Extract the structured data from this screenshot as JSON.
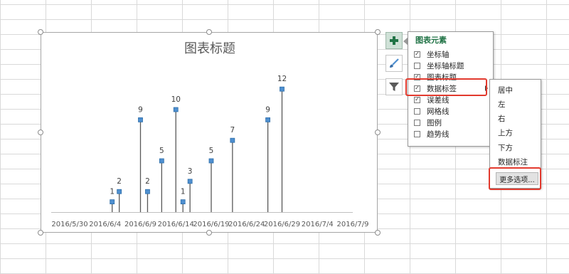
{
  "spreadsheet": {
    "gridline_color": "#d9d9d9"
  },
  "chart": {
    "title": "图表标题"
  },
  "chart_data": {
    "type": "scatter",
    "style": "drop-lines",
    "title": "图表标题",
    "x_tick_labels": [
      "2016/5/30",
      "2016/6/4",
      "2016/6/9",
      "2016/6/14",
      "2016/6/19",
      "2016/6/24",
      "2016/6/29",
      "2016/7/4",
      "2016/7/9"
    ],
    "xlim": [
      "2016/5/30",
      "2016/7/9"
    ],
    "ylim": [
      0,
      13
    ],
    "points": [
      {
        "x": "2016/6/5",
        "y": 1
      },
      {
        "x": "2016/6/6",
        "y": 2
      },
      {
        "x": "2016/6/9",
        "y": 9
      },
      {
        "x": "2016/6/10",
        "y": 2
      },
      {
        "x": "2016/6/12",
        "y": 5
      },
      {
        "x": "2016/6/14",
        "y": 10
      },
      {
        "x": "2016/6/15",
        "y": 1
      },
      {
        "x": "2016/6/16",
        "y": 3
      },
      {
        "x": "2016/6/19",
        "y": 5
      },
      {
        "x": "2016/6/22",
        "y": 7
      },
      {
        "x": "2016/6/27",
        "y": 9
      },
      {
        "x": "2016/6/29",
        "y": 12
      }
    ],
    "marker_color": "#4e8fd0",
    "line_color": "#595959",
    "data_labels": true,
    "legend": "none"
  },
  "chart_buttons": {
    "elements_icon": "plus-icon",
    "styles_icon": "brush-icon",
    "filter_icon": "funnel-icon"
  },
  "elements_panel": {
    "title": "图表元素",
    "items": [
      {
        "label": "坐标轴",
        "checked": true
      },
      {
        "label": "坐标轴标题",
        "checked": false
      },
      {
        "label": "图表标题",
        "checked": true
      },
      {
        "label": "数据标签",
        "checked": true
      },
      {
        "label": "误差线",
        "checked": true
      },
      {
        "label": "网格线",
        "checked": false
      },
      {
        "label": "图例",
        "checked": false
      },
      {
        "label": "趋势线",
        "checked": false
      }
    ]
  },
  "label_submenu": {
    "items": [
      "居中",
      "左",
      "右",
      "上方",
      "下方",
      "数据标注"
    ],
    "more_options": "更多选项..."
  },
  "colors": {
    "accent_green": "#217346",
    "highlight_red": "#e23a2e"
  }
}
